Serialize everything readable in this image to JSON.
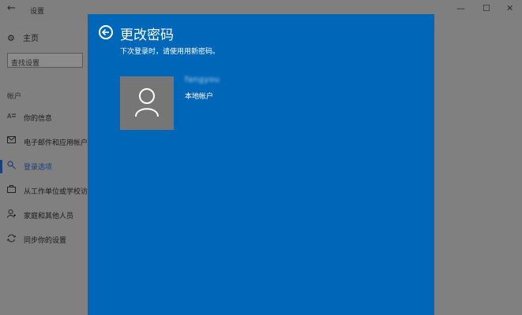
{
  "window": {
    "title": "设置",
    "back_glyph": "←",
    "minimize_glyph": "—",
    "maximize_glyph": "☐",
    "close_glyph": "✕"
  },
  "sidebar": {
    "home_label": "主页",
    "search_placeholder": "查找设置",
    "section_label": "帐户",
    "items": [
      {
        "label": "你的信息",
        "icon": "person-card-icon"
      },
      {
        "label": "电子邮件和应用帐户",
        "icon": "mail-icon"
      },
      {
        "label": "登录选项",
        "icon": "key-icon",
        "selected": true
      },
      {
        "label": "从工作单位或学校访问",
        "icon": "briefcase-icon"
      },
      {
        "label": "家庭和其他人员",
        "icon": "people-icon"
      },
      {
        "label": "同步你的设置",
        "icon": "sync-icon"
      }
    ]
  },
  "dialog": {
    "title": "更改密码",
    "subtitle": "下次登录时，请使用用新密码。",
    "user_name": "fangyou",
    "account_type": "本地帐户"
  },
  "colors": {
    "dialog_bg": "#0067b8",
    "avatar_bg": "#767676",
    "overlay": "#808080"
  }
}
